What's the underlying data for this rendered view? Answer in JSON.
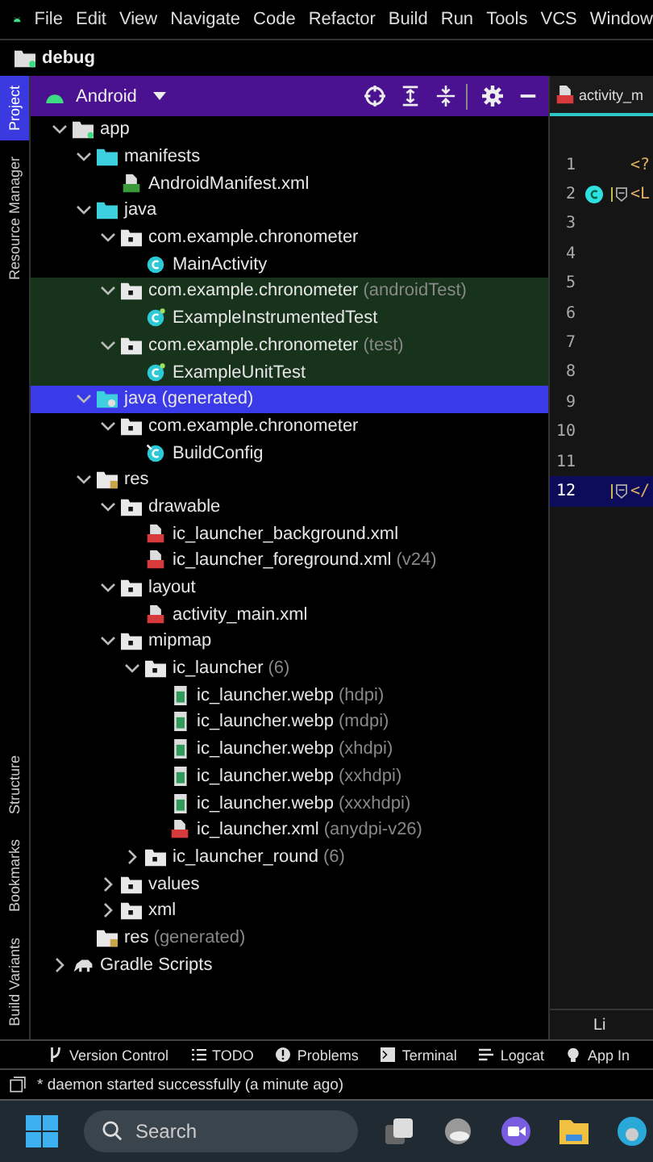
{
  "menu": [
    {
      "label": "File"
    },
    {
      "label": "Edit"
    },
    {
      "label": "View"
    },
    {
      "label": "Navigate"
    },
    {
      "label": "Code"
    },
    {
      "label": "Refactor"
    },
    {
      "label": "Build"
    },
    {
      "label": "Run"
    },
    {
      "label": "Tools"
    },
    {
      "label": "VCS"
    },
    {
      "label": "Window"
    }
  ],
  "toolbar": {
    "config": "debug"
  },
  "side_tabs_top": [
    {
      "label": "Project",
      "selected": true
    },
    {
      "label": "Resource Manager",
      "selected": false
    }
  ],
  "side_tabs_bottom": [
    {
      "label": "Structure",
      "selected": false
    },
    {
      "label": "Bookmarks",
      "selected": false
    },
    {
      "label": "Build Variants",
      "selected": false
    }
  ],
  "project_panel": {
    "view": "Android",
    "tree": [
      {
        "label": "app",
        "kind": "module",
        "expanded": true,
        "selected": false,
        "test": false,
        "children": [
          {
            "label": "manifests",
            "kind": "source-folder",
            "expanded": true,
            "selected": false,
            "test": false,
            "children": [
              {
                "label": "AndroidManifest.xml",
                "kind": "manifest",
                "selected": false,
                "test": false
              }
            ]
          },
          {
            "label": "java",
            "kind": "source-folder",
            "expanded": true,
            "selected": false,
            "test": false,
            "children": [
              {
                "label": "com.example.chronometer",
                "kind": "package",
                "expanded": true,
                "selected": false,
                "test": false,
                "children": [
                  {
                    "label": "MainActivity",
                    "kind": "class",
                    "selected": false,
                    "test": false
                  }
                ]
              },
              {
                "label": "com.example.chronometer",
                "suffix": "(androidTest)",
                "kind": "package",
                "expanded": true,
                "selected": false,
                "test": true,
                "children": [
                  {
                    "label": "ExampleInstrumentedTest",
                    "kind": "test-class",
                    "selected": false,
                    "test": true
                  }
                ]
              },
              {
                "label": "com.example.chronometer",
                "suffix": "(test)",
                "kind": "package",
                "expanded": true,
                "selected": false,
                "test": true,
                "children": [
                  {
                    "label": "ExampleUnitTest",
                    "kind": "test-class",
                    "selected": false,
                    "test": true
                  }
                ]
              }
            ]
          },
          {
            "label": "java (generated)",
            "kind": "generated-folder",
            "expanded": true,
            "selected": true,
            "test": false,
            "children": [
              {
                "label": "com.example.chronometer",
                "kind": "package",
                "expanded": true,
                "selected": false,
                "test": false,
                "children": [
                  {
                    "label": "BuildConfig",
                    "kind": "class-locked",
                    "selected": false,
                    "test": false
                  }
                ]
              }
            ]
          },
          {
            "label": "res",
            "kind": "res-folder",
            "expanded": true,
            "selected": false,
            "test": false,
            "children": [
              {
                "label": "drawable",
                "kind": "package",
                "expanded": true,
                "selected": false,
                "test": false,
                "children": [
                  {
                    "label": "ic_launcher_background.xml",
                    "kind": "xml",
                    "selected": false,
                    "test": false
                  },
                  {
                    "label": "ic_launcher_foreground.xml",
                    "suffix": "(v24)",
                    "kind": "xml",
                    "selected": false,
                    "test": false
                  }
                ]
              },
              {
                "label": "layout",
                "kind": "package",
                "expanded": true,
                "selected": false,
                "test": false,
                "children": [
                  {
                    "label": "activity_main.xml",
                    "kind": "xml",
                    "selected": false,
                    "test": false
                  }
                ]
              },
              {
                "label": "mipmap",
                "kind": "package",
                "expanded": true,
                "selected": false,
                "test": false,
                "children": [
                  {
                    "label": "ic_launcher",
                    "suffix": "(6)",
                    "kind": "package",
                    "expanded": true,
                    "selected": false,
                    "test": false,
                    "children": [
                      {
                        "label": "ic_launcher.webp",
                        "suffix": "(hdpi)",
                        "kind": "image",
                        "selected": false,
                        "test": false
                      },
                      {
                        "label": "ic_launcher.webp",
                        "suffix": "(mdpi)",
                        "kind": "image",
                        "selected": false,
                        "test": false
                      },
                      {
                        "label": "ic_launcher.webp",
                        "suffix": "(xhdpi)",
                        "kind": "image",
                        "selected": false,
                        "test": false
                      },
                      {
                        "label": "ic_launcher.webp",
                        "suffix": "(xxhdpi)",
                        "kind": "image",
                        "selected": false,
                        "test": false
                      },
                      {
                        "label": "ic_launcher.webp",
                        "suffix": "(xxxhdpi)",
                        "kind": "image",
                        "selected": false,
                        "test": false
                      },
                      {
                        "label": "ic_launcher.xml",
                        "suffix": "(anydpi-v26)",
                        "kind": "xml",
                        "selected": false,
                        "test": false
                      }
                    ]
                  },
                  {
                    "label": "ic_launcher_round",
                    "suffix": "(6)",
                    "kind": "package",
                    "expanded": false,
                    "selected": false,
                    "test": false
                  }
                ]
              },
              {
                "label": "values",
                "kind": "package",
                "expanded": false,
                "selected": false,
                "test": false
              },
              {
                "label": "xml",
                "kind": "package",
                "expanded": false,
                "selected": false,
                "test": false
              }
            ]
          },
          {
            "label": "res",
            "suffix": "(generated)",
            "kind": "res-folder",
            "selected": false,
            "test": false
          }
        ]
      },
      {
        "label": "Gradle Scripts",
        "kind": "gradle",
        "expanded": false,
        "selected": false,
        "test": false
      }
    ]
  },
  "editor": {
    "tab": "activity_m",
    "lines": [
      {
        "number": "1",
        "code": "<?",
        "marker": false,
        "fold": false,
        "current": false
      },
      {
        "number": "2",
        "code": "<L",
        "marker": true,
        "fold": true,
        "current": false
      },
      {
        "number": "3",
        "marker": false,
        "fold": false,
        "current": false
      },
      {
        "number": "4",
        "marker": false,
        "fold": false,
        "current": false
      },
      {
        "number": "5",
        "marker": false,
        "fold": false,
        "current": false
      },
      {
        "number": "6",
        "marker": false,
        "fold": false,
        "current": false
      },
      {
        "number": "7",
        "marker": false,
        "fold": false,
        "current": false
      },
      {
        "number": "8",
        "marker": false,
        "fold": false,
        "current": false
      },
      {
        "number": "9",
        "marker": false,
        "fold": false,
        "current": false
      },
      {
        "number": "10",
        "marker": false,
        "fold": false,
        "current": false
      },
      {
        "number": "11",
        "marker": false,
        "fold": false,
        "current": false
      },
      {
        "number": "12",
        "code": "</",
        "marker": false,
        "fold": true,
        "current": true
      }
    ],
    "footer": "Li"
  },
  "tool_windows": [
    {
      "label": "Version Control",
      "kind": "vcs"
    },
    {
      "label": "TODO",
      "kind": "list"
    },
    {
      "label": "Problems",
      "kind": "alert"
    },
    {
      "label": "Terminal",
      "kind": "terminal"
    },
    {
      "label": "Logcat",
      "kind": "logcat"
    },
    {
      "label": "App In",
      "kind": "inspect"
    }
  ],
  "status_bar": "* daemon started successfully (a minute ago)",
  "taskbar": {
    "search_placeholder": "Search"
  }
}
